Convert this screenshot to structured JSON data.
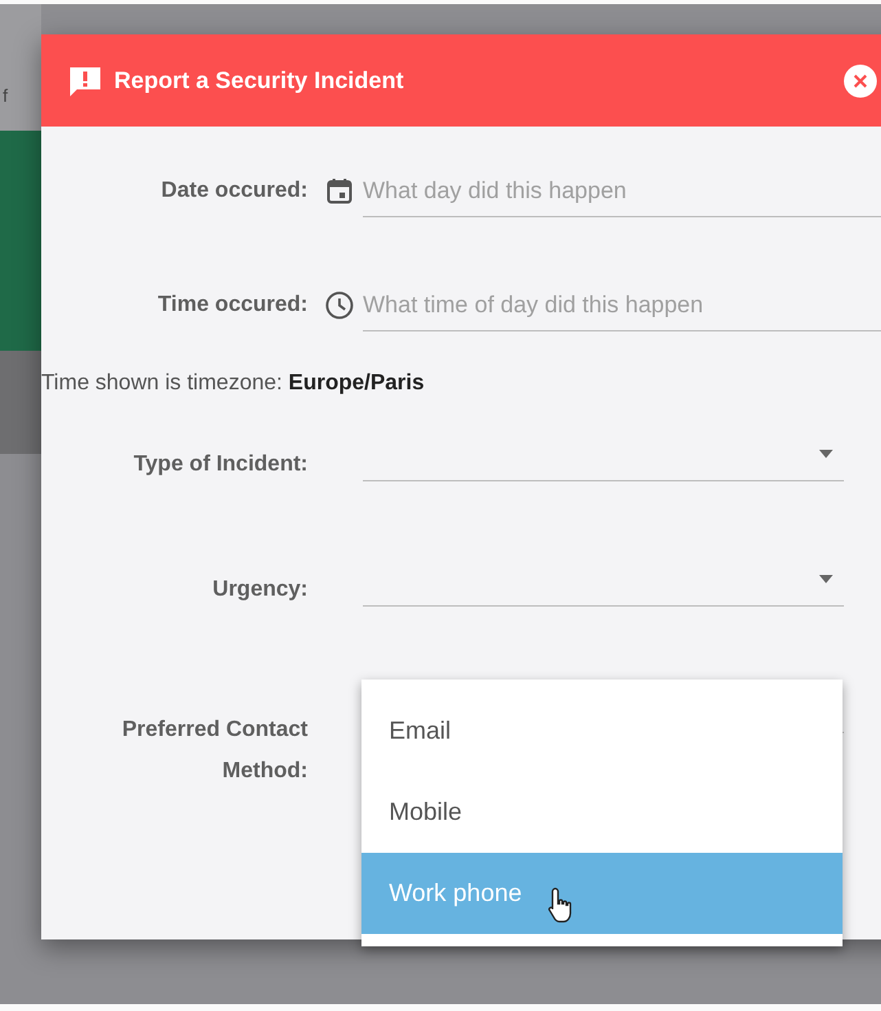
{
  "background": {
    "text": "f"
  },
  "dialog": {
    "title": "Report a Security Incident",
    "inputs": [
      {
        "kind": "date",
        "label": "Date occured:",
        "placeholder": "What day did this happen"
      },
      {
        "kind": "time",
        "label": "Time occured:",
        "placeholder": "What time of day did this happen"
      }
    ],
    "timezone_note": "Time shown is timezone: **Europe/Paris**",
    "selects": [
      {
        "label": "Type of Incident:"
      },
      {
        "label": "Urgency:"
      },
      {
        "label": "Preferred Contact Method:",
        "options": [
          {
            "label": "Email",
            "selected": false
          },
          {
            "label": "Mobile",
            "selected": false
          },
          {
            "label": "Work phone",
            "selected": true
          }
        ]
      }
    ]
  }
}
